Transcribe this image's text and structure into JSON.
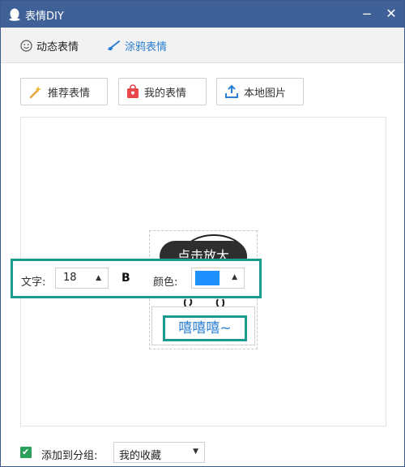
{
  "window": {
    "title": "表情DIY",
    "minimize_symbol": "−",
    "close_symbol": "✕",
    "app_icon": "penguin-icon"
  },
  "mode_tabs": [
    {
      "label": "动态表情",
      "icon": "smiley-icon",
      "active": false
    },
    {
      "label": "涂鸦表情",
      "icon": "brush-icon",
      "active": true
    }
  ],
  "toolbar": {
    "recommend_label": "推荐表情",
    "mine_label": "我的表情",
    "local_label": "本地图片"
  },
  "canvas": {
    "tooltip": "点击放大",
    "caption_text": "嘻嘻嘻~"
  },
  "text_toolbar": {
    "size_label": "文字:",
    "size_value": "18",
    "bold_label": "B",
    "color_label": "颜色:",
    "color_value": "#1e90ff"
  },
  "footer": {
    "checked": true,
    "group_label": "添加到分组:",
    "group_value": "我的收藏"
  },
  "colors": {
    "titlebar": "#3f6198",
    "highlight_border": "#1a9a8f",
    "accent": "#2a7fd4",
    "checkbox": "#2aa05a"
  }
}
